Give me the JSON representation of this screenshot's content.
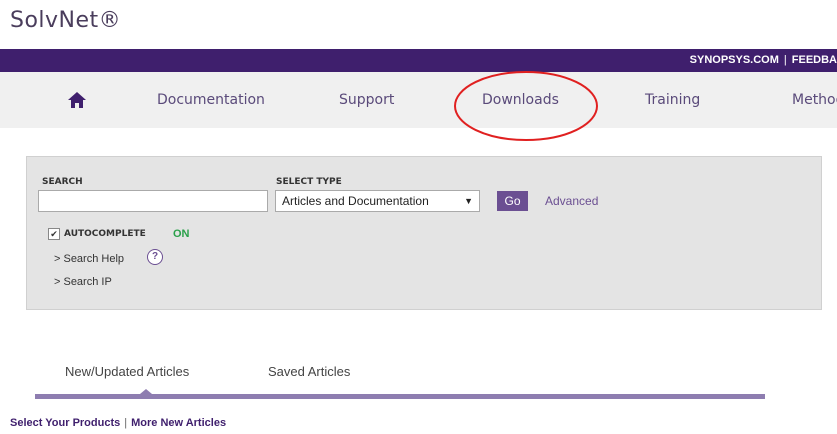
{
  "app": {
    "logo": "SolvNet®"
  },
  "topbar": {
    "site_link": "SYNOPSYS.COM",
    "separator": "|",
    "feedback_link": "FEEDBA"
  },
  "nav": {
    "home_icon": "home-icon",
    "items": [
      "Documentation",
      "Support",
      "Downloads",
      "Training",
      "Method"
    ]
  },
  "search": {
    "search_label": "SEARCH",
    "search_value": "",
    "select_label": "SELECT TYPE",
    "select_value": "Articles and Documentation",
    "go_label": "Go",
    "advanced_label": "Advanced",
    "autocomplete_label": "AUTOCOMPLETE",
    "autocomplete_status": "ON",
    "search_help_label": "> Search Help",
    "help_icon_glyph": "?",
    "search_ip_label": "> Search IP"
  },
  "tabs": {
    "items": [
      "New/Updated Articles",
      "Saved Articles"
    ]
  },
  "bottom_links": {
    "select_products": "Select Your Products",
    "separator": "|",
    "more_articles": "More New Articles"
  },
  "colors": {
    "brand_purple": "#3f1f6d",
    "accent_purple": "#6b4f92",
    "status_green": "#2aa04a",
    "annotation_red": "#e02020"
  }
}
